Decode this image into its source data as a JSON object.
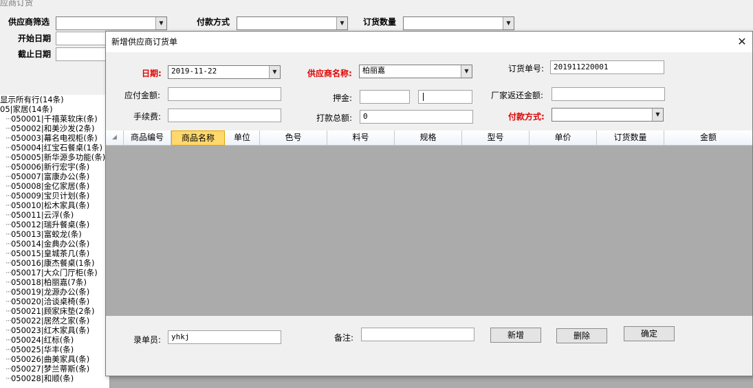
{
  "window": {
    "partial_title": "应商订货"
  },
  "filters": {
    "supplier_label": "供应商筛选",
    "payment_label": "付款方式",
    "qty_label": "订货数量",
    "start_label": "开始日期",
    "end_label": "截止日期"
  },
  "tree": {
    "root_all": "显示所有行(14条)",
    "category": "05|家居(14条)",
    "items": [
      "050001|千禧莱软床(条)",
      "050002|和美沙发(2条)",
      "050003|幕名电视柜(条)",
      "050004|红宝石餐桌(1条)",
      "050005|新华源多功能(条)",
      "050006|新行宏宇(条)",
      "050007|富康办公(条)",
      "050008|金亿家居(条)",
      "050009|宝贝计划(条)",
      "050010|松木家具(条)",
      "050011|云浮(条)",
      "050012|瑞升餐桌(条)",
      "050013|富蛟龙(条)",
      "050014|金典办公(条)",
      "050015|皇城茶几(条)",
      "050016|康杰餐桌(1条)",
      "050017|大众门厅柜(条)",
      "050018|柏丽嘉(7条)",
      "050019|龙源办公(条)",
      "050020|洽谈桌椅(条)",
      "050021|顾家床垫(2条)",
      "050022|居然之家(条)",
      "050023|红木家具(条)",
      "050024|红标(条)",
      "050025|华丰(条)",
      "050026|曲美家具(条)",
      "050027|梦兰蒂斯(条)",
      "050028|和顺(条)"
    ]
  },
  "dialog": {
    "title": "新增供应商订货单",
    "close_glyph": "✕",
    "date_label": "日期:",
    "date_value": "2019-11-22",
    "supplier_label": "供应商名称:",
    "supplier_value": "柏丽嘉",
    "order_no_label": "订货单号:",
    "order_no_value": "201911220001",
    "payable_label": "应付金额:",
    "deposit_label": "押金:",
    "rebate_label": "厂家返还金额:",
    "fee_label": "手续费:",
    "total_label": "打款总额:",
    "total_value": "0",
    "pay_method_label": "付款方式:",
    "columns": [
      "商品编号",
      "商品名称",
      "单位",
      "色号",
      "料号",
      "规格",
      "型号",
      "单价",
      "订货数量",
      "金额"
    ],
    "operator_label": "录单员:",
    "operator_value": "yhkj",
    "remark_label": "备注:",
    "add_button": "新增",
    "delete_button": "删除",
    "confirm_button": "确定"
  },
  "colors": {
    "required_label": "#e00000",
    "selected_header": "#ffd86e",
    "grid_background": "#ababab"
  },
  "icons": {
    "combo_arrow": "▼",
    "row_indicator": "◢"
  }
}
